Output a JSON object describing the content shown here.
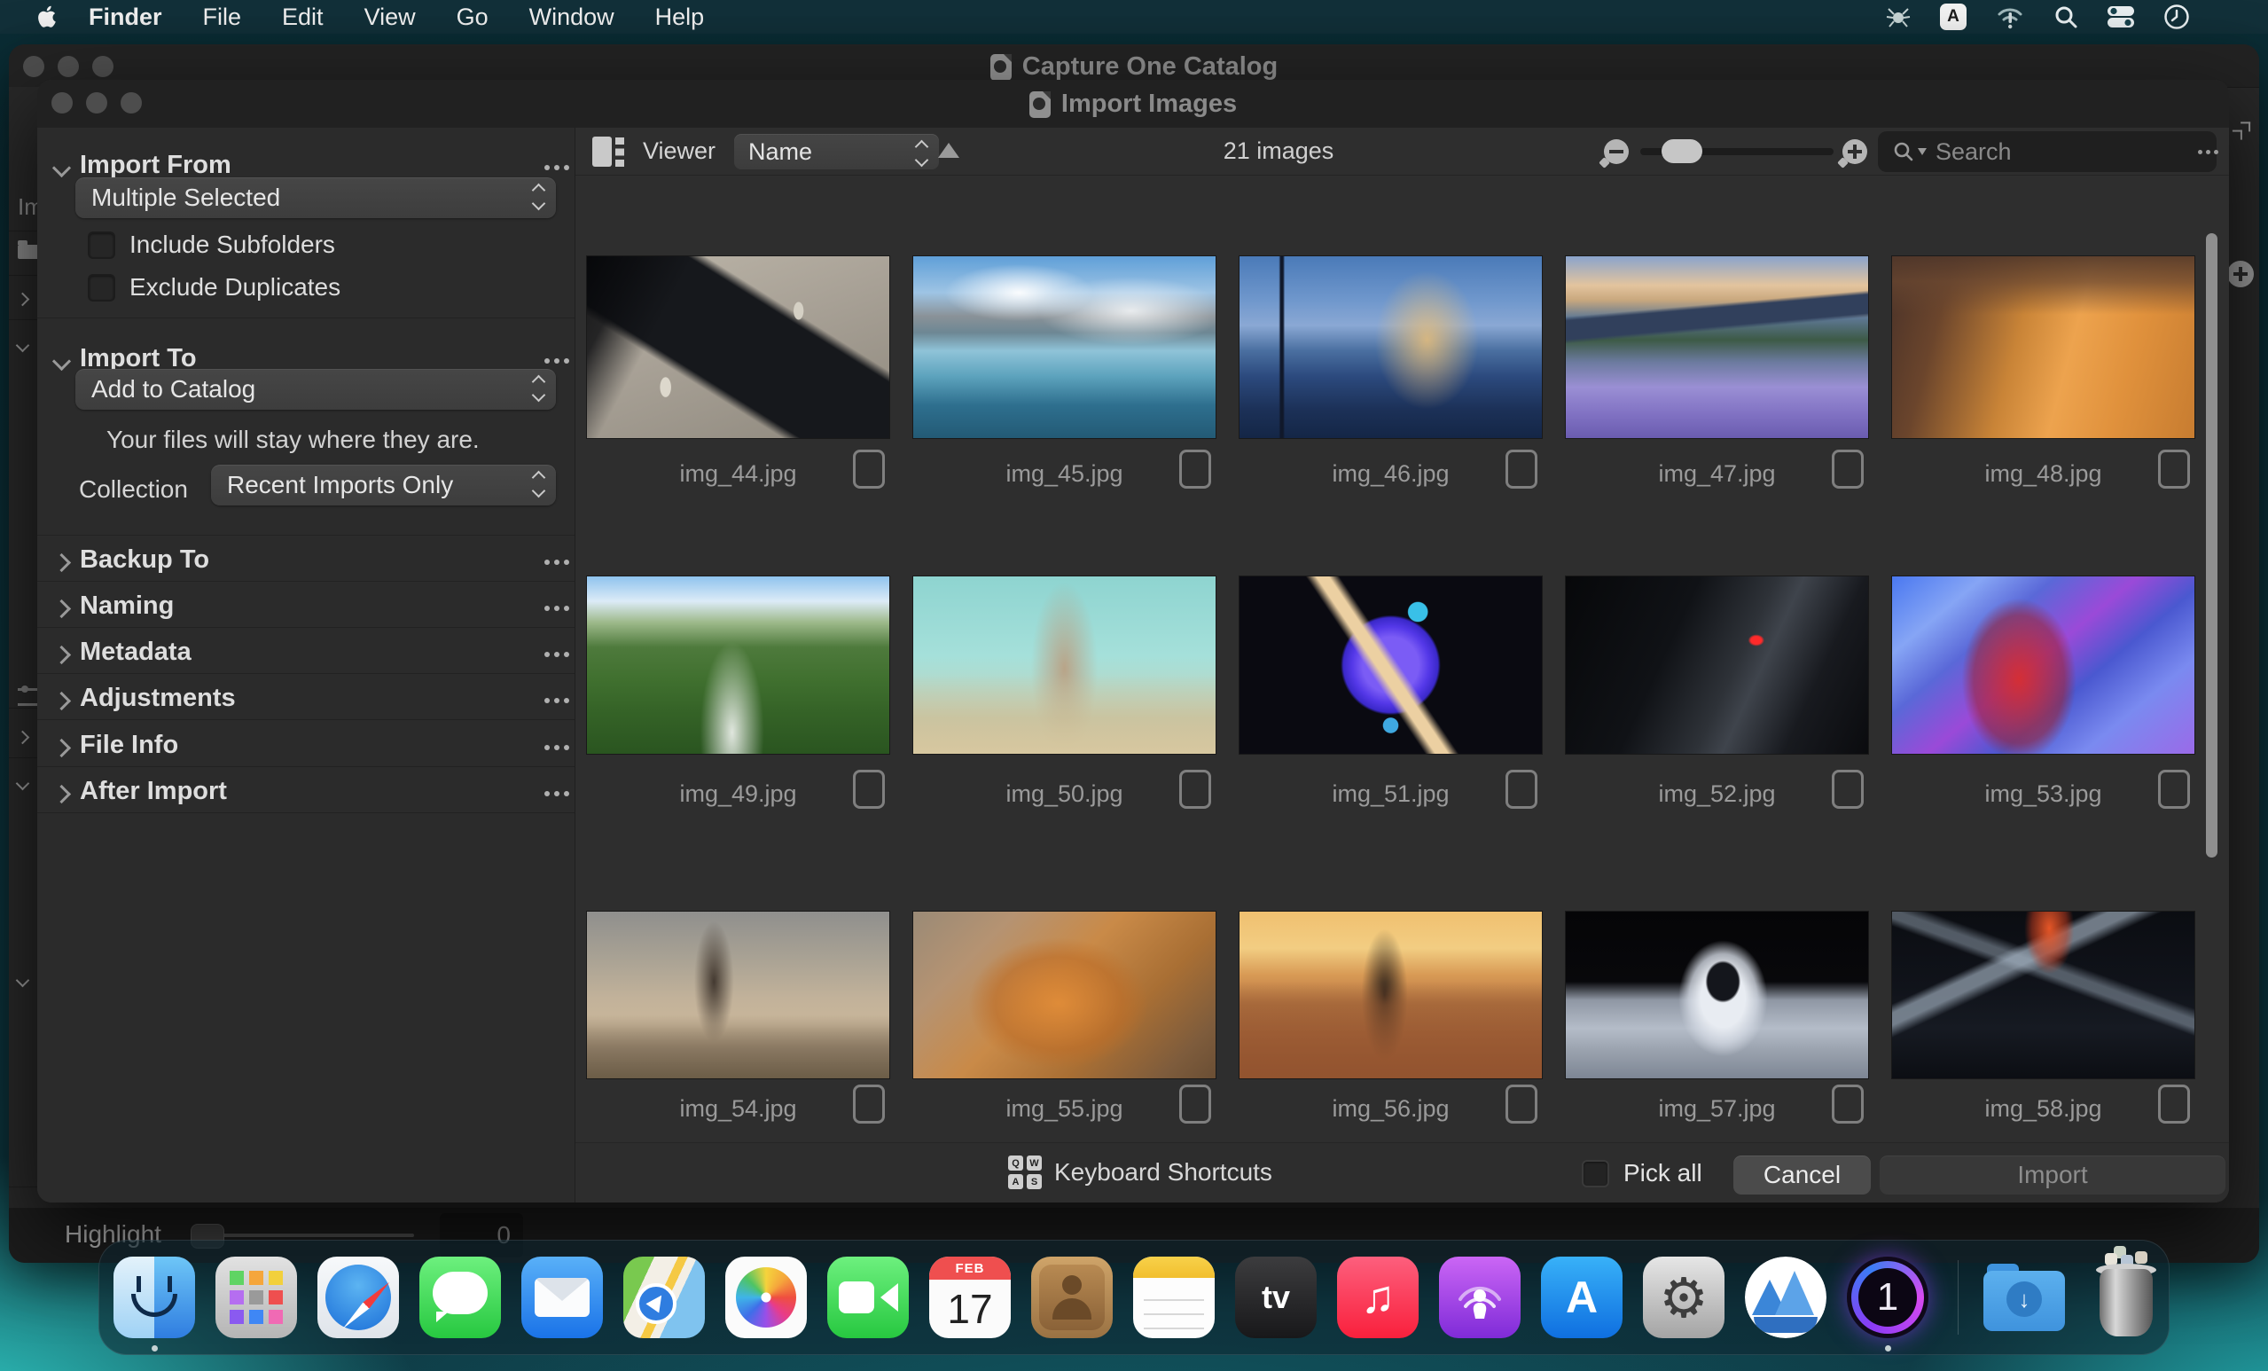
{
  "menu_bar": {
    "app_name": "Finder",
    "items": [
      "File",
      "Edit",
      "View",
      "Go",
      "Window",
      "Help"
    ],
    "keyboard_layout_label": "A",
    "status_icons": [
      "drweb-antivirus",
      "keyboard-layout",
      "wifi-alert",
      "spotlight",
      "control-center",
      "clock"
    ]
  },
  "background_window": {
    "title": "Capture One Catalog",
    "sidebar_clipped_label": "Im",
    "highlight": {
      "label": "Highlight",
      "value": "0"
    }
  },
  "dialog": {
    "title": "Import Images",
    "sidebar": {
      "import_from": {
        "label": "Import From",
        "selected": "Multiple Selected",
        "checkboxes": [
          {
            "label": "Include Subfolders",
            "checked": false
          },
          {
            "label": "Exclude Duplicates",
            "checked": false
          }
        ]
      },
      "import_to": {
        "label": "Import To",
        "selected": "Add to Catalog",
        "note": "Your files will stay where they are.",
        "collection_label": "Collection",
        "collection_selected": "Recent Imports Only"
      },
      "sections": [
        "Backup To",
        "Naming",
        "Metadata",
        "Adjustments",
        "File Info",
        "After Import"
      ]
    },
    "toolbar": {
      "viewer_label": "Viewer",
      "sort_by": "Name",
      "image_count": "21 images",
      "search_placeholder": "Search"
    },
    "grid": {
      "images": [
        {
          "filename": "img_44.jpg",
          "subject": "pistol with ammunition on fabric"
        },
        {
          "filename": "img_45.jpg",
          "subject": "mountain lake with ice"
        },
        {
          "filename": "img_46.jpg",
          "subject": "castle reflection at dusk"
        },
        {
          "filename": "img_47.jpg",
          "subject": "lupine flower field and mountains"
        },
        {
          "filename": "img_48.jpg",
          "subject": "ginger kitten"
        },
        {
          "filename": "img_49.jpg",
          "subject": "alpine valley with stream"
        },
        {
          "filename": "img_50.jpg",
          "subject": "woman in a field"
        },
        {
          "filename": "img_51.jpg",
          "subject": "ringed planet artwork"
        },
        {
          "filename": "img_52.jpg",
          "subject": "dark portrait with red eye"
        },
        {
          "filename": "img_53.jpg",
          "subject": "spider-man artwork"
        },
        {
          "filename": "img_54.jpg",
          "subject": "wanderer in dusty desert"
        },
        {
          "filename": "img_55.jpg",
          "subject": "resting fox"
        },
        {
          "filename": "img_56.jpg",
          "subject": "tennis player at sunset"
        },
        {
          "filename": "img_57.jpg",
          "subject": "astronaut on the moon"
        },
        {
          "filename": "img_58.jpg",
          "subject": "dark figure with flame"
        }
      ]
    },
    "footer": {
      "keyboard_shortcuts_label": "Keyboard Shortcuts",
      "keys": [
        "Q",
        "W",
        "A",
        "S"
      ],
      "pick_all_label": "Pick all",
      "cancel_label": "Cancel",
      "import_label": "Import"
    }
  },
  "dock": {
    "items": [
      "finder",
      "launchpad",
      "safari",
      "messages",
      "mail",
      "maps",
      "photos",
      "facetime",
      "calendar",
      "contacts",
      "notes",
      "tv",
      "music",
      "podcasts",
      "app-store",
      "system-settings",
      "mountain-app",
      "capture-one",
      "downloads",
      "trash"
    ],
    "calendar": {
      "month": "FEB",
      "day": "17"
    },
    "tv_label": "tv",
    "app_store_label": "A"
  },
  "icons": {
    "music_glyph": "♫",
    "gear_glyph": "⚙",
    "download_arrow_glyph": "↓"
  },
  "colors": {
    "desktop_teal": "#0d343d",
    "dialog_bg": "#2d2d2d",
    "menu_bar": "#13333b"
  }
}
